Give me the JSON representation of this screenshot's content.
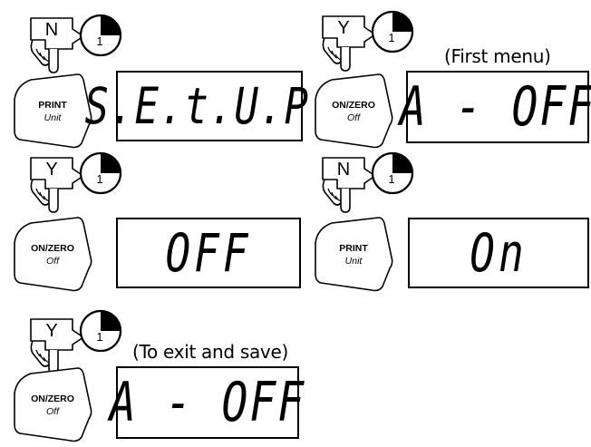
{
  "steps": [
    {
      "hand_letter": "N",
      "timer_number": "1",
      "key": {
        "line1": "PRINT",
        "line2": "Unit"
      },
      "display": "S.E.t.U.P.",
      "note": ""
    },
    {
      "hand_letter": "Y",
      "timer_number": "1",
      "key": {
        "line1": "ON/ZERO",
        "line2": "Off"
      },
      "display": "A - OFF",
      "note": "(First menu)"
    },
    {
      "hand_letter": "Y",
      "timer_number": "1",
      "key": {
        "line1": "ON/ZERO",
        "line2": "Off"
      },
      "display": "OFF",
      "note": ""
    },
    {
      "hand_letter": "N",
      "timer_number": "1",
      "key": {
        "line1": "PRINT",
        "line2": "Unit"
      },
      "display": "On",
      "note": ""
    },
    {
      "hand_letter": "Y",
      "timer_number": "1",
      "key": {
        "line1": "ON/ZERO",
        "line2": "Off"
      },
      "display": "A - OFF",
      "note": "(To exit and save)"
    }
  ],
  "icons": {
    "hand": "pointing-hand-icon",
    "timer": "timer-icon"
  }
}
